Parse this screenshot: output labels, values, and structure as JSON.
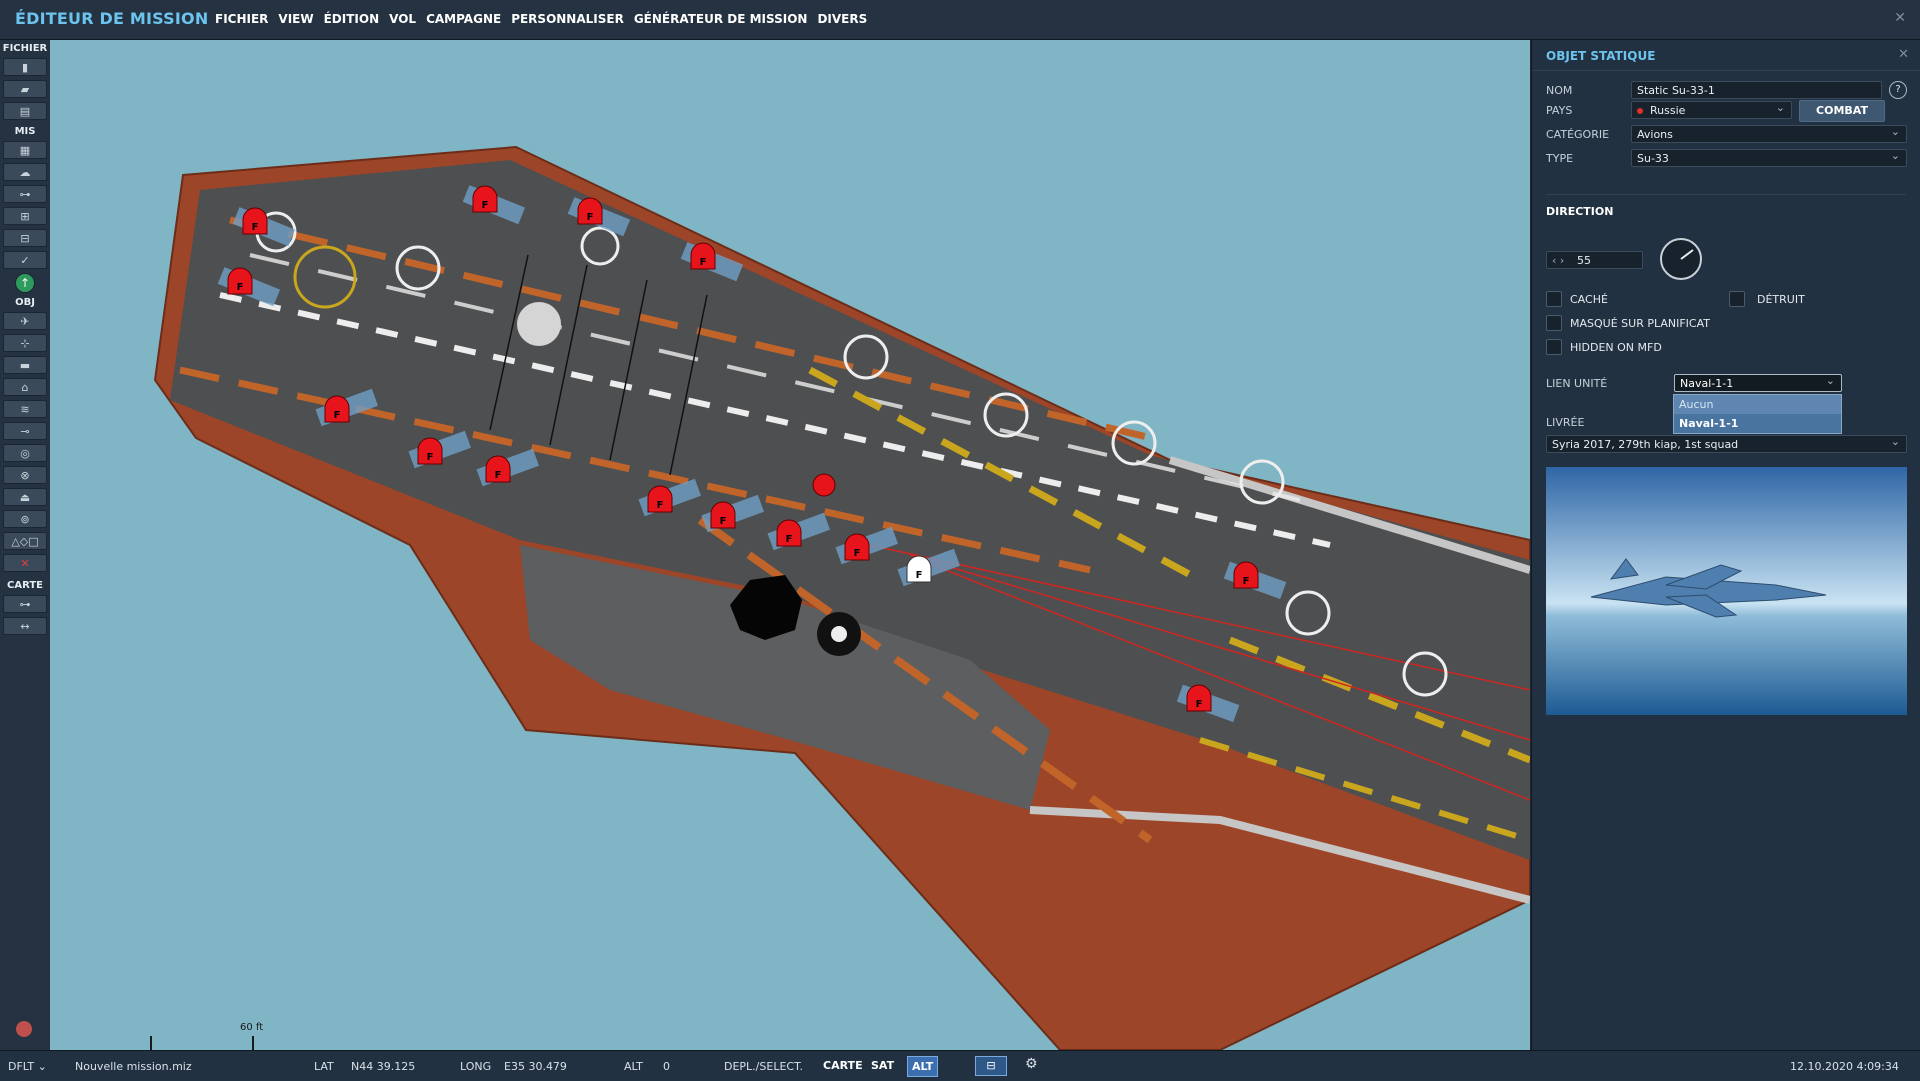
{
  "app": {
    "title": "ÉDITEUR DE MISSION",
    "menu": [
      "FICHIER",
      "VIEW",
      "ÉDITION",
      "VOL",
      "CAMPAGNE",
      "PERSONNALISER",
      "GÉNÉRATEUR DE MISSION",
      "DIVERS"
    ]
  },
  "toolbar": {
    "sections": {
      "file": "FICHIER",
      "mission": "MIS",
      "objects": "OBJ",
      "map": "CARTE"
    }
  },
  "map": {
    "scale_label": "60 ft"
  },
  "panel": {
    "title": "OBJET STATIQUE",
    "name_label": "NOM",
    "name_value": "Static Su-33-1",
    "country_label": "PAYS",
    "country_value": "Russie",
    "combat_label": "COMBAT",
    "category_label": "CATÉGORIE",
    "category_value": "Avions",
    "type_label": "TYPE",
    "type_value": "Su-33",
    "direction_title": "DIRECTION",
    "heading_value": "55",
    "hidden_label": "CACHÉ",
    "destroyed_label": "DÉTRUIT",
    "hidden_planner_label": "MASQUÉ SUR PLANIFICAT",
    "hidden_mfd_label": "HIDDEN ON MFD",
    "link_unit_label": "LIEN UNITÉ",
    "link_unit_value": "Naval-1-1",
    "link_unit_options": [
      "Aucun",
      "Naval-1-1"
    ],
    "livery_label": "LIVRÉE",
    "livery_value": "Syria 2017, 279th kiap, 1st squad"
  },
  "status": {
    "profile": "DFLT",
    "file": "Nouvelle mission.miz",
    "lat_label": "LAT",
    "lat_value": "N44 39.125",
    "long_label": "LONG",
    "long_value": "E35 30.479",
    "alt_label": "ALT",
    "alt_value": "0",
    "mode_label": "DEPL./SELECT.",
    "map_modes": [
      "CARTE",
      "SAT",
      "ALT"
    ],
    "datetime": "12.10.2020 4:09:34"
  },
  "colors": {
    "accent": "#6cc4ee",
    "sea": "#7fb5c4",
    "deck": "#4a4c4e",
    "hull": "#a34a2c",
    "unit_red": "#e8141c"
  }
}
